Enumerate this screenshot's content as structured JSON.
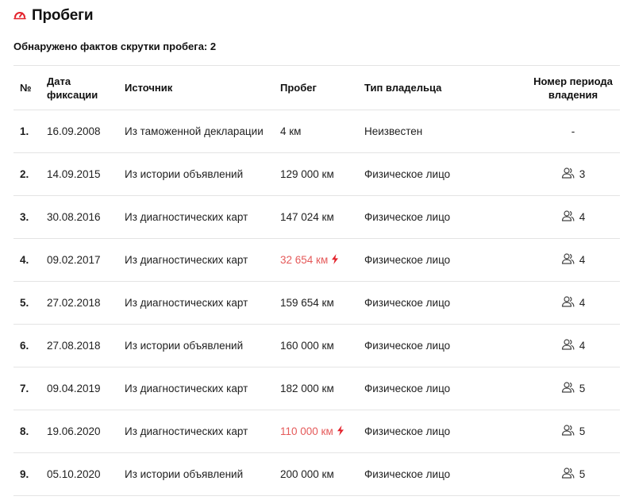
{
  "section": {
    "title": "Пробеги",
    "icon": "speedometer-icon",
    "accent": "#e3232c"
  },
  "summary": "Обнаружено фактов скрутки пробега: 2",
  "table": {
    "headers": {
      "num": "№",
      "date_line1": "Дата",
      "date_line2": "фиксации",
      "source": "Источник",
      "mileage": "Пробег",
      "owner_type": "Тип владельца",
      "period_line1": "Номер периода",
      "period_line2": "владения"
    },
    "rows": [
      {
        "num": "1.",
        "date": "16.09.2008",
        "source": "Из таможенной декларации",
        "mileage": "4 км",
        "owner_type": "Неизвестен",
        "period": "-",
        "suspicious": false
      },
      {
        "num": "2.",
        "date": "14.09.2015",
        "source": "Из истории объявлений",
        "mileage": "129 000 км",
        "owner_type": "Физическое лицо",
        "period": "3",
        "suspicious": false
      },
      {
        "num": "3.",
        "date": "30.08.2016",
        "source": "Из диагностических карт",
        "mileage": "147 024 км",
        "owner_type": "Физическое лицо",
        "period": "4",
        "suspicious": false
      },
      {
        "num": "4.",
        "date": "09.02.2017",
        "source": "Из диагностических карт",
        "mileage": "32 654 км",
        "owner_type": "Физическое лицо",
        "period": "4",
        "suspicious": true
      },
      {
        "num": "5.",
        "date": "27.02.2018",
        "source": "Из диагностических карт",
        "mileage": "159 654 км",
        "owner_type": "Физическое лицо",
        "period": "4",
        "suspicious": false
      },
      {
        "num": "6.",
        "date": "27.08.2018",
        "source": "Из истории объявлений",
        "mileage": "160 000 км",
        "owner_type": "Физическое лицо",
        "period": "4",
        "suspicious": false
      },
      {
        "num": "7.",
        "date": "09.04.2019",
        "source": "Из диагностических карт",
        "mileage": "182 000 км",
        "owner_type": "Физическое лицо",
        "period": "5",
        "suspicious": false
      },
      {
        "num": "8.",
        "date": "19.06.2020",
        "source": "Из диагностических карт",
        "mileage": "110 000 км",
        "owner_type": "Физическое лицо",
        "period": "5",
        "suspicious": true
      },
      {
        "num": "9.",
        "date": "05.10.2020",
        "source": "Из истории объявлений",
        "mileage": "200 000 км",
        "owner_type": "Физическое лицо",
        "period": "5",
        "suspicious": false
      }
    ]
  },
  "colors": {
    "warning_text": "#e55a5a",
    "bolt": "#e3232c",
    "divider": "#e4e4e4"
  }
}
